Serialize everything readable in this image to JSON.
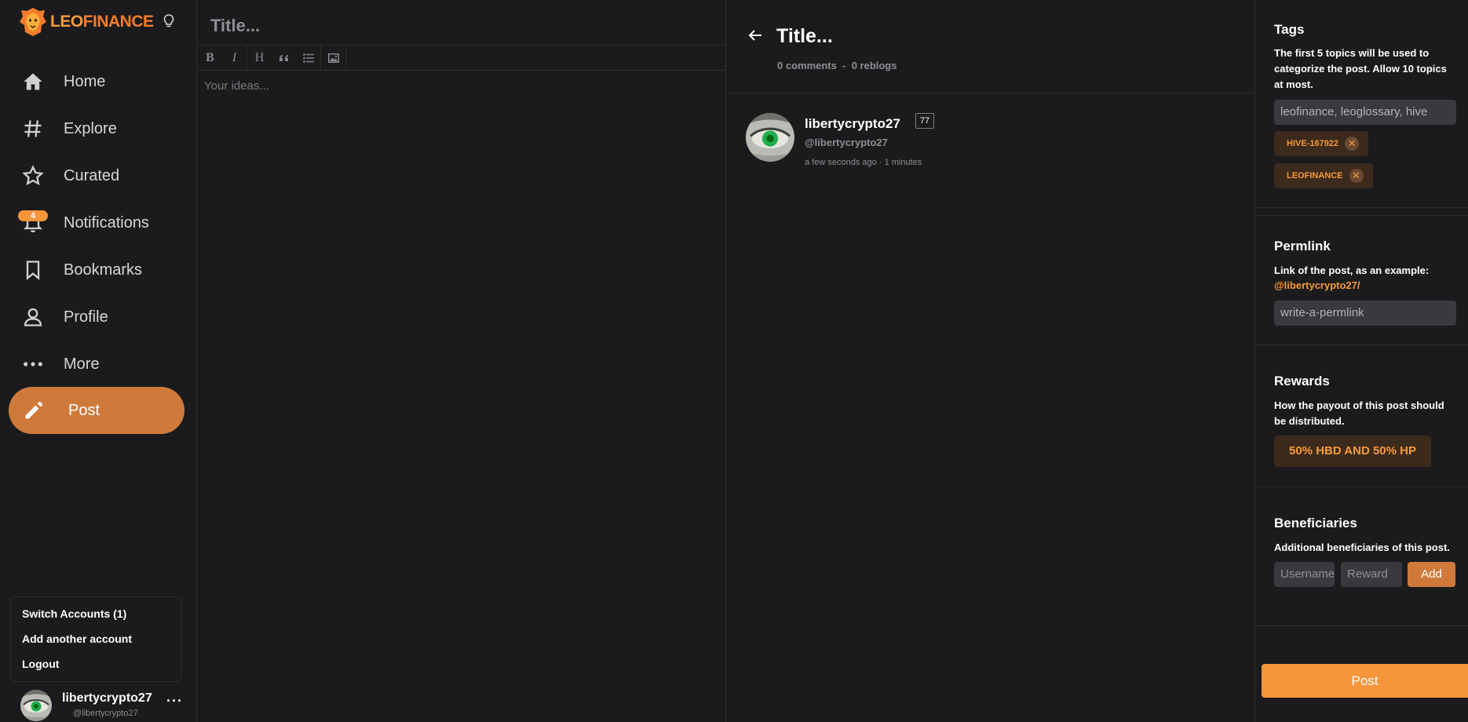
{
  "brand": {
    "name_part1": "LEO",
    "name_part2": "FINANCE"
  },
  "nav": {
    "items": [
      {
        "label": "Home"
      },
      {
        "label": "Explore"
      },
      {
        "label": "Curated"
      },
      {
        "label": "Notifications",
        "badge": "4"
      },
      {
        "label": "Bookmarks"
      },
      {
        "label": "Profile"
      },
      {
        "label": "More"
      }
    ],
    "post_label": "Post"
  },
  "account_menu": {
    "switch": "Switch Accounts (1)",
    "add": "Add another account",
    "logout": "Logout"
  },
  "user": {
    "name": "libertycrypto27",
    "handle": "@libertycrypto27",
    "reputation": "77"
  },
  "editor": {
    "title_placeholder": "Title...",
    "body_placeholder": "Your ideas..."
  },
  "preview": {
    "title": "Title...",
    "comments": "0 comments",
    "separator": "-",
    "reblogs": "0 reblogs",
    "time": "a few seconds ago",
    "time_sep": "·",
    "read_time": "1 minutes"
  },
  "panel": {
    "tags": {
      "title": "Tags",
      "desc": "The first 5 topics will be used to categorize the post. Allow 10 topics at most.",
      "placeholder": "leofinance, leoglossary, hive",
      "items": [
        "HIVE-167922",
        "LEOFINANCE"
      ]
    },
    "permlink": {
      "title": "Permlink",
      "desc": "Link of the post, as an example:",
      "user": "@libertycrypto27/",
      "placeholder": "write-a-permlink"
    },
    "rewards": {
      "title": "Rewards",
      "desc": "How the payout of this post should be distributed.",
      "option": "50% HBD AND 50% HP"
    },
    "beneficiaries": {
      "title": "Beneficiaries",
      "desc": "Additional beneficiaries of this post.",
      "username_placeholder": "Username",
      "reward_placeholder": "Reward",
      "add_label": "Add"
    },
    "post_label": "Post"
  },
  "colors": {
    "accent": "#f7953a",
    "accent_dark": "#cf7a3b",
    "bg": "#1b1b1d",
    "border": "#2e2e31"
  }
}
